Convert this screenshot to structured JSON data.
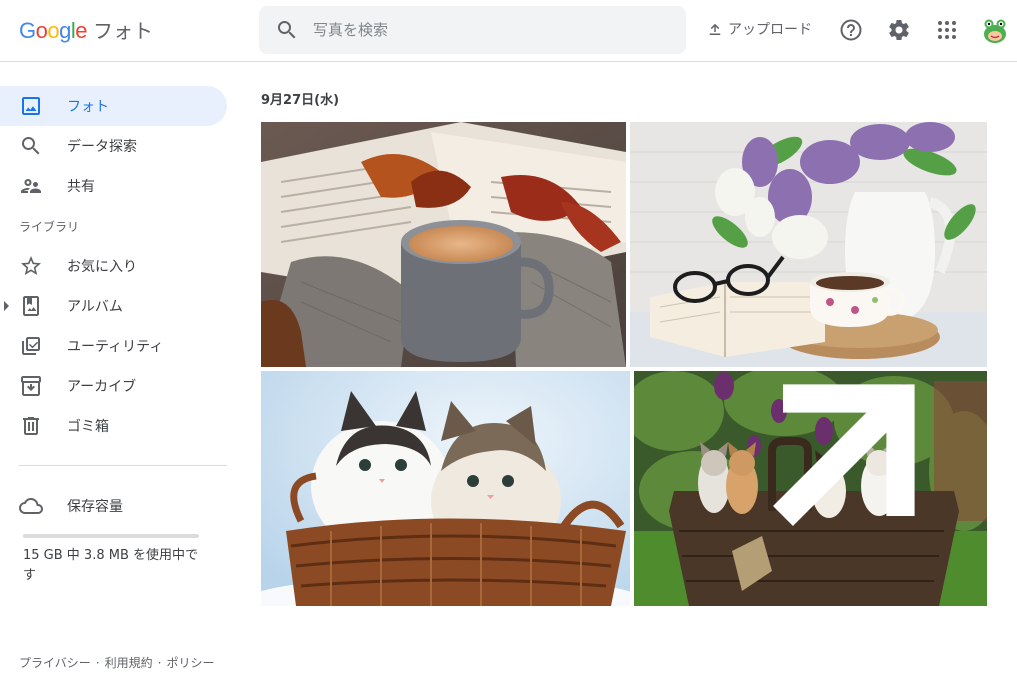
{
  "header": {
    "logo_product": "フォト",
    "search_placeholder": "写真を検索",
    "upload_label": "アップロード"
  },
  "sidebar": {
    "items": [
      {
        "label": "フォト",
        "icon": "photo-icon"
      },
      {
        "label": "データ探索",
        "icon": "search-icon"
      },
      {
        "label": "共有",
        "icon": "people-icon"
      }
    ],
    "library_label": "ライブラリ",
    "library_items": [
      {
        "label": "お気に入り",
        "icon": "star-icon"
      },
      {
        "label": "アルバム",
        "icon": "album-icon"
      },
      {
        "label": "ユーティリティ",
        "icon": "checklist-icon"
      },
      {
        "label": "アーカイブ",
        "icon": "archive-icon"
      },
      {
        "label": "ゴミ箱",
        "icon": "trash-icon"
      }
    ],
    "storage_label": "保存容量",
    "storage_usage": "15 GB 中 3.8 MB を使用中です",
    "storage_fraction": 0.0003
  },
  "footer": {
    "privacy": "プライバシー",
    "terms": "利用規約",
    "policy": "ポリシー",
    "separator": "·"
  },
  "main": {
    "date": "9月27日(水)"
  },
  "colors": {
    "accent": "#1a73e8",
    "active_bg": "#e8f0fe",
    "search_bg": "#f1f3f4"
  }
}
